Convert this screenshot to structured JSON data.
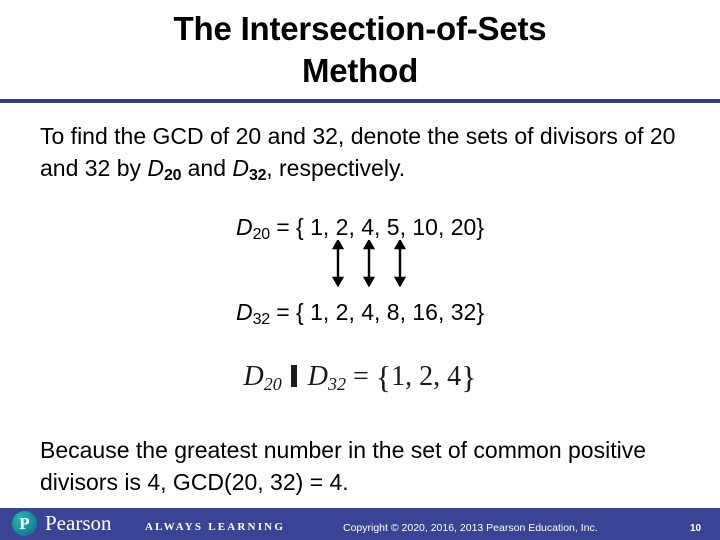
{
  "slide": {
    "title_line1": "The Intersection-of-Sets",
    "title_line2": "Method",
    "paragraph_top": {
      "seg1": "To find the GCD of 20 and 32, denote the sets of divisors of 20 and 32 by ",
      "d_a": "D",
      "d_a_sub": "20",
      "seg2": " and ",
      "d_b": "D",
      "d_b_sub": "32",
      "seg3": ", respectively."
    },
    "set_d20": {
      "symbol": "D",
      "subscript": "20",
      "equals": " = { 1, 2, 4, 5, 10, 20}"
    },
    "set_d32": {
      "symbol": "D",
      "subscript": "32",
      "equals": " = { 1, 2, 4, 8, 16, 32}"
    },
    "equation": {
      "left_symbol": "D",
      "left_sub": "20",
      "operator": "∩",
      "right_symbol": "D",
      "right_sub": "32",
      "equals": " = ",
      "open_brace": "{",
      "result": "1, 2, 4",
      "close_brace": "}"
    },
    "paragraph_bottom": "Because the greatest number in the set of common positive divisors is 4, GCD(20, 32) = 4.",
    "arrow_count": 3
  },
  "footer": {
    "brand": "Pearson",
    "brand_mark_letter": "P",
    "tagline": "ALWAYS LEARNING",
    "copyright": "Copyright © 2020, 2016, 2013 Pearson Education, Inc.",
    "page_number": "10"
  },
  "colors": {
    "divider": "#363F7E",
    "footer_bar": "#3A4494",
    "text": "#000000",
    "footer_text": "#FFFFFF",
    "brand_mark": "#17939B"
  }
}
